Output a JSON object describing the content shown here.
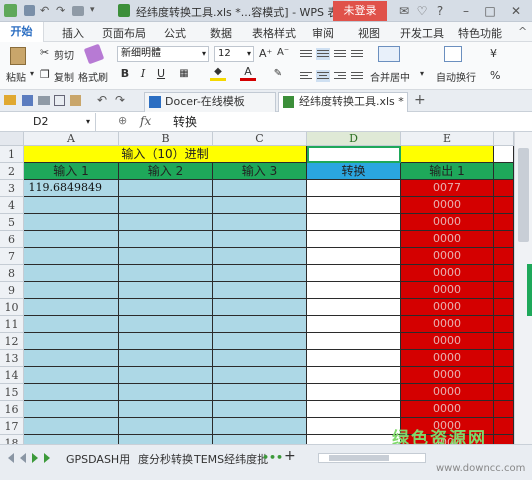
{
  "window": {
    "title": "经纬度转换工具.xls *...容模式] - WPS 表格",
    "login_button": "未登录"
  },
  "menu": [
    "开始",
    "插入",
    "页面布局",
    "公式",
    "数据",
    "表格样式",
    "审阅",
    "视图",
    "开发工具",
    "特色功能"
  ],
  "ribbon": {
    "cut": "剪切",
    "paste": "粘贴",
    "copy": "复制",
    "format_painter": "格式刷",
    "font_name": "新细明體",
    "font_size": "12",
    "bold": "B",
    "italic": "I",
    "underline": "U",
    "increase_font": "A⁺",
    "decrease_font": "A⁻",
    "font_color_glyph": "A",
    "merge_center": "合并居中",
    "wrap_text": "自动换行",
    "currency": "¥"
  },
  "tabs": {
    "docer": "Docer-在线模板",
    "file": "经纬度转换工具.xls *"
  },
  "formula_bar": {
    "cell_ref": "D2",
    "fx": "fx",
    "content": "转换"
  },
  "sheet": {
    "columns": [
      "A",
      "B",
      "C",
      "D",
      "E"
    ],
    "rows": [
      "1",
      "2",
      "3",
      "4",
      "5",
      "6",
      "7",
      "8",
      "9",
      "10",
      "11",
      "12",
      "13",
      "14",
      "15",
      "16",
      "17",
      "18"
    ],
    "title": "输入（10）进制",
    "headers": {
      "input1": "输入 1",
      "input2": "输入 2",
      "input3": "输入 3",
      "convert": "转换",
      "output1": "输出 1"
    },
    "a3": "119.6849849",
    "e3": "0077",
    "e_fill": "0000"
  },
  "sheet_tabs": [
    "GPSDASH用",
    "度分秒转换",
    "TEMS经纬度批"
  ],
  "watermark": {
    "line1": "绿色资源网",
    "line2": "www.downcc.com"
  },
  "colors": {
    "title_yellow": "#ffff00",
    "header_green": "#1ea85a",
    "convert_blue": "#2aa6e0",
    "input_blue": "#add8e6",
    "output_red": "#d40000",
    "login_red": "#e0524a"
  }
}
